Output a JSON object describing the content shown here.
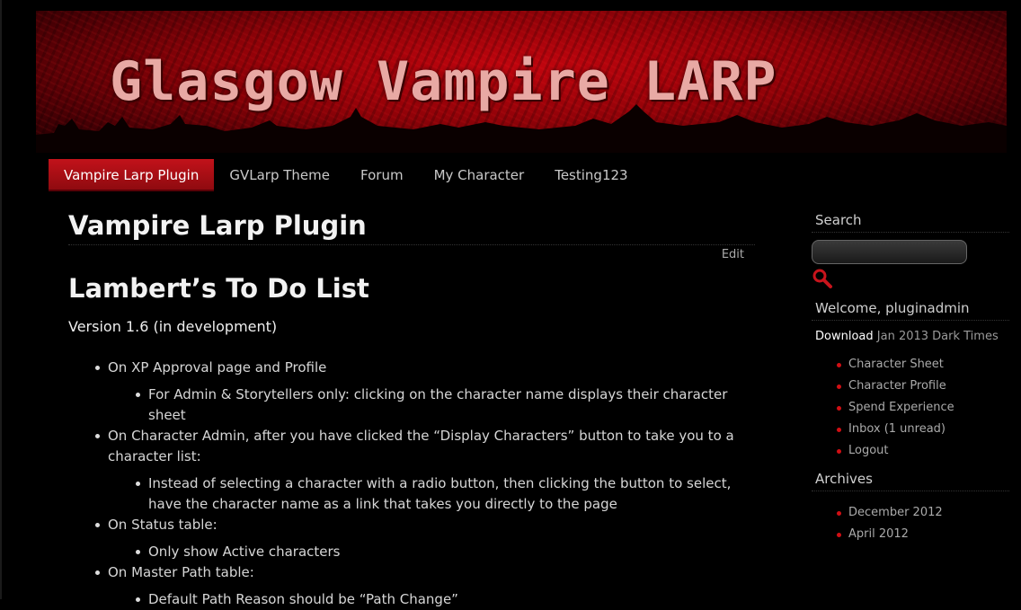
{
  "site": {
    "title": "Glasgow Vampire LARP"
  },
  "nav": {
    "items": [
      {
        "label": "Vampire Larp Plugin",
        "active": true
      },
      {
        "label": "GVLarp Theme"
      },
      {
        "label": "Forum"
      },
      {
        "label": "My Character"
      },
      {
        "label": "Testing123"
      }
    ]
  },
  "main": {
    "page_title": "Vampire Larp Plugin",
    "edit_label": "Edit",
    "post_title": "Lambert’s To Do List",
    "version": "Version 1.6 (in development)",
    "items": [
      {
        "text": "On XP Approval page and Profile",
        "sub": "For Admin & Storytellers only: clicking on the character name displays their character sheet"
      },
      {
        "text": "On Character Admin, after you have clicked the “Display Characters” button to take you to a character list:",
        "sub": "Instead of selecting a character with a radio button, then clicking the button to select, have the character name as a link that takes you directly to the page"
      },
      {
        "text": "On Status table:",
        "sub": "Only show Active characters"
      },
      {
        "text": "On Master Path table:",
        "sub": "Default Path Reason should be “Path Change”"
      }
    ]
  },
  "sidebar": {
    "search": {
      "title": "Search",
      "placeholder": ""
    },
    "welcome": {
      "title": "Welcome, pluginadmin",
      "download_label": "Download",
      "download_detail": "Jan 2013 Dark Times",
      "links": [
        "Character Sheet",
        "Character Profile",
        "Spend Experience",
        "Inbox (1 unread)",
        "Logout"
      ]
    },
    "archives": {
      "title": "Archives",
      "links": [
        "December 2012",
        "April 2012"
      ]
    }
  },
  "colors": {
    "accent": "#b0101a",
    "bullet_red": "#d10f14",
    "background": "#000000"
  },
  "icons": {
    "search": "magnifier-icon"
  }
}
